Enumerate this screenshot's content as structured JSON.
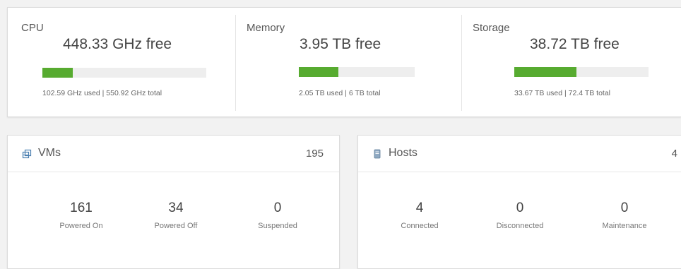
{
  "resources": {
    "cpu": {
      "title": "CPU",
      "free": "448.33 GHz free",
      "detail": "102.59 GHz used | 550.92 GHz total",
      "used_fraction": 0.186
    },
    "memory": {
      "title": "Memory",
      "free": "3.95 TB free",
      "detail": "2.05 TB used | 6 TB total",
      "used_fraction": 0.342
    },
    "storage": {
      "title": "Storage",
      "free": "38.72 TB free",
      "detail": "33.67 TB used | 72.4 TB total",
      "used_fraction": 0.465
    }
  },
  "vms": {
    "title": "VMs",
    "count": "195",
    "icon": "vm-icon",
    "stats": [
      {
        "value": "161",
        "label": "Powered On"
      },
      {
        "value": "34",
        "label": "Powered Off"
      },
      {
        "value": "0",
        "label": "Suspended"
      }
    ]
  },
  "hosts": {
    "title": "Hosts",
    "count": "4",
    "icon": "host-icon",
    "stats": [
      {
        "value": "4",
        "label": "Connected"
      },
      {
        "value": "0",
        "label": "Disconnected"
      },
      {
        "value": "0",
        "label": "Maintenance"
      }
    ]
  },
  "colors": {
    "bar_fill": "#57ab30",
    "bar_track": "#eeeeee",
    "icon_blue": "#4a7fb0"
  }
}
